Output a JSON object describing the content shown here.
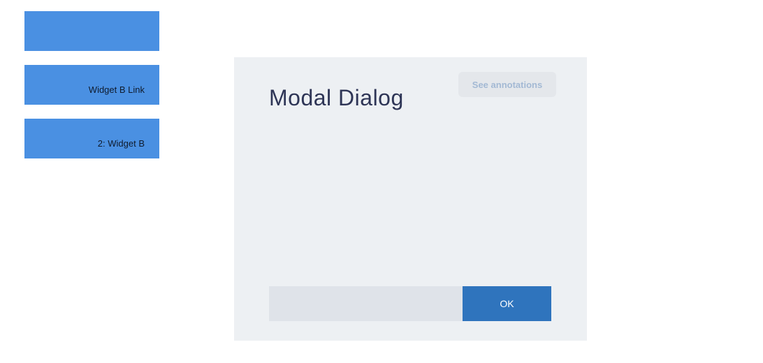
{
  "widgets": {
    "items": [
      {
        "label": ""
      },
      {
        "label": "Widget B Link"
      },
      {
        "label": "2: Widget B"
      }
    ]
  },
  "modal": {
    "title": "Modal Dialog",
    "annotations_button": "See annotations",
    "ok_label": "OK"
  },
  "colors": {
    "widget_bg": "#4a90e2",
    "modal_bg": "#edf0f3",
    "title": "#2e3556",
    "ok_bg": "#2f74bd",
    "field_bg": "#dfe3e9"
  }
}
